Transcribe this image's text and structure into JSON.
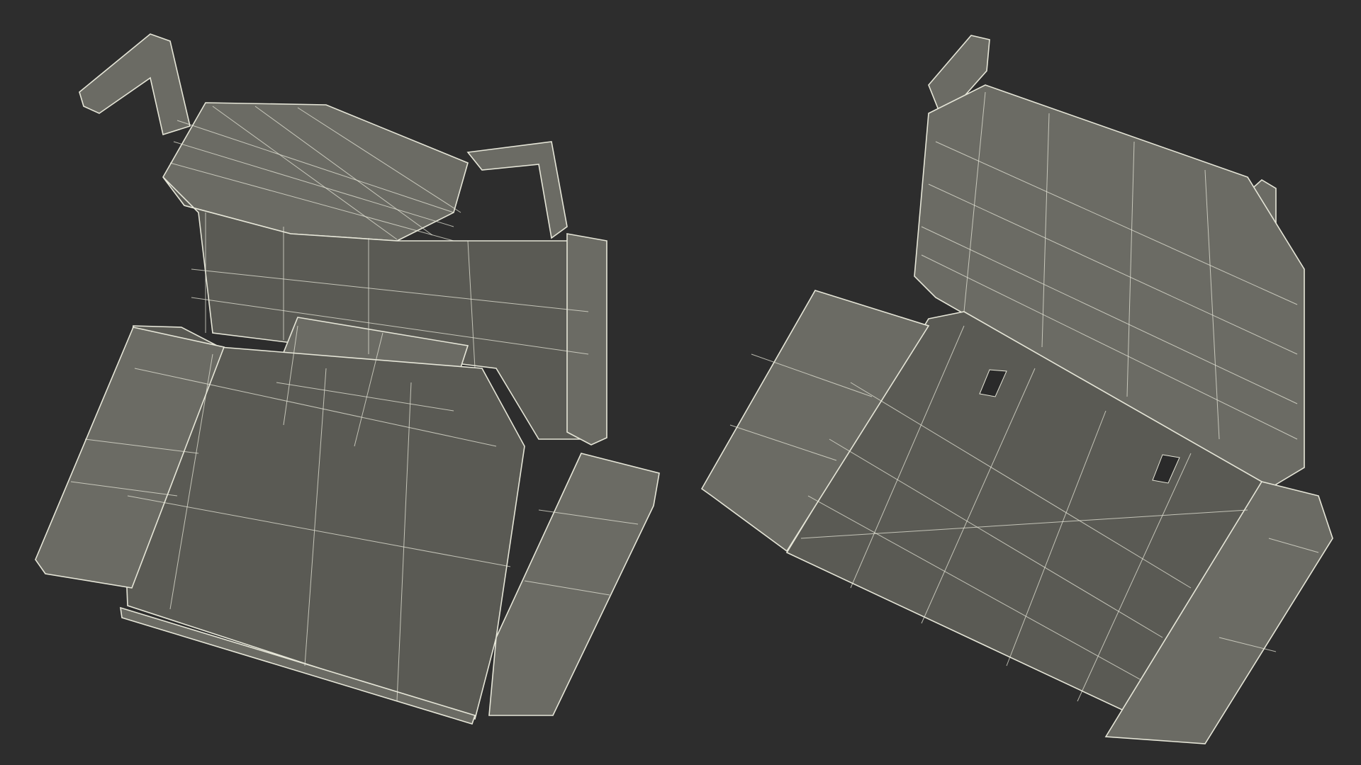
{
  "scene": {
    "background_color": "#2d2d2d",
    "surface_color": "#6b6b64",
    "surface_dark_color": "#5a5a54",
    "wire_color": "#e6e6d8",
    "models": [
      {
        "view": "front-three-quarter",
        "subject": "folding-seat-wireframe"
      },
      {
        "view": "rear-three-quarter",
        "subject": "folding-seat-wireframe"
      }
    ]
  }
}
